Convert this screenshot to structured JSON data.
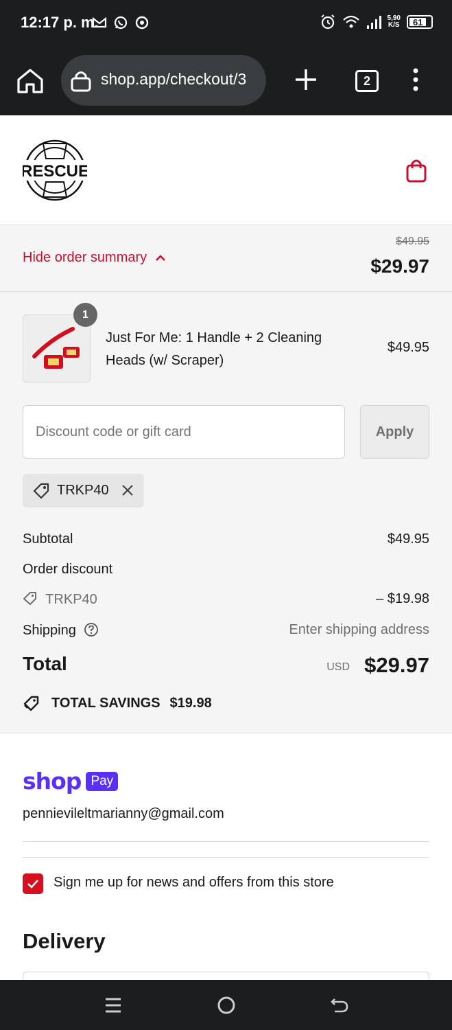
{
  "status_bar": {
    "time": "12:17 p. m.",
    "net_speed_value": "5,90",
    "net_speed_unit": "K/S",
    "battery": "61"
  },
  "browser": {
    "url": "shop.app/checkout/3",
    "tab_count": "2"
  },
  "store": {
    "logo_text": "RESCUE"
  },
  "summary_toggle": {
    "label": "Hide order summary",
    "original_price": "$49.95",
    "price": "$29.97"
  },
  "cart": {
    "items": [
      {
        "quantity": "1",
        "name": "Just For Me: 1 Handle + 2 Cleaning Heads (w/ Scraper)",
        "price": "$49.95"
      }
    ]
  },
  "discount": {
    "placeholder": "Discount code or gift card",
    "apply_label": "Apply",
    "applied_code": "TRKP40"
  },
  "totals": {
    "subtotal_label": "Subtotal",
    "subtotal_value": "$49.95",
    "order_discount_label": "Order discount",
    "discount_code": "TRKP40",
    "discount_value": "– $19.98",
    "shipping_label": "Shipping",
    "shipping_value": "Enter shipping address",
    "total_label": "Total",
    "currency": "USD",
    "total_value": "$29.97",
    "savings_label": "TOTAL SAVINGS",
    "savings_value": "$19.98"
  },
  "contact": {
    "shop_word": "shop",
    "pay_word": "Pay",
    "email": "pennievileltmarianny@gmail.com",
    "newsletter_label": "Sign me up for news and offers from this store",
    "newsletter_checked": true
  },
  "delivery": {
    "heading": "Delivery"
  },
  "colors": {
    "accent": "#c8102e",
    "shop_pay": "#5a31f4",
    "checkbox": "#d4101f"
  }
}
